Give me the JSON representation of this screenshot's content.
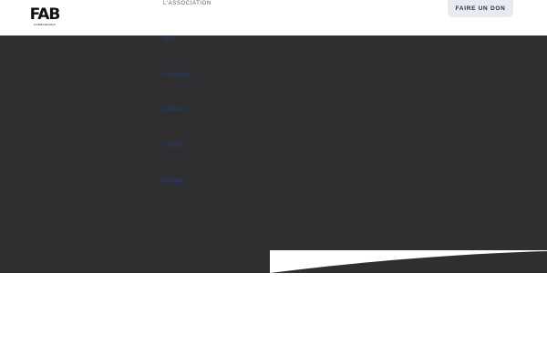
{
  "header": {
    "logo": {
      "letters": "FAB",
      "tagline": "FORBANDANS"
    },
    "nav_top_label": "L'ASSOCIATION",
    "donate_label": "FAIRE UN DON"
  },
  "submenu": {
    "items": [
      {
        "label": "Qui?"
      },
      {
        "label": "Les Projets"
      },
      {
        "label": "Adhérent"
      },
      {
        "label": "Contact"
      },
      {
        "label": "Partager"
      }
    ]
  },
  "colors": {
    "dark_background": "#2f2f31",
    "link": "#1d3f8a",
    "donate_bg": "#e8eaf0",
    "donate_text": "#1f2a44"
  }
}
